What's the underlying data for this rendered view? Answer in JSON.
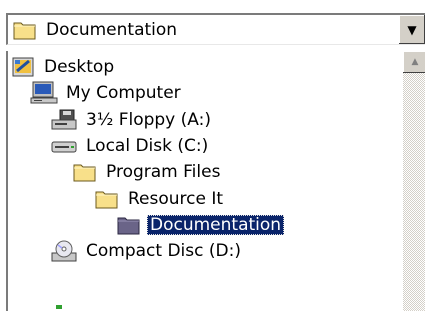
{
  "combo": {
    "selected": "Documentation",
    "dropdown_icon": "chevron-down-icon"
  },
  "tree": [
    {
      "label": "Desktop",
      "icon": "desktop-icon",
      "level": 0
    },
    {
      "label": "My Computer",
      "icon": "my-computer-icon",
      "level": 1
    },
    {
      "label": "3½ Floppy (A:)",
      "icon": "floppy-drive-icon",
      "level": 2
    },
    {
      "label": "Local Disk (C:)",
      "icon": "hard-disk-icon",
      "level": 2
    },
    {
      "label": "Program Files",
      "icon": "folder-icon",
      "level": 3
    },
    {
      "label": "Resource It",
      "icon": "folder-icon",
      "level": 4
    },
    {
      "label": "Documentation",
      "icon": "folder-open-selected-icon",
      "level": 5,
      "selected": true
    },
    {
      "label": "Compact Disc (D:)",
      "icon": "cd-drive-icon",
      "level": 2
    }
  ],
  "colors": {
    "selection_bg": "#0a246a",
    "selection_text": "#ffffff",
    "folder_yellow": "#f8e08a",
    "chrome": "#d4d0c8"
  }
}
